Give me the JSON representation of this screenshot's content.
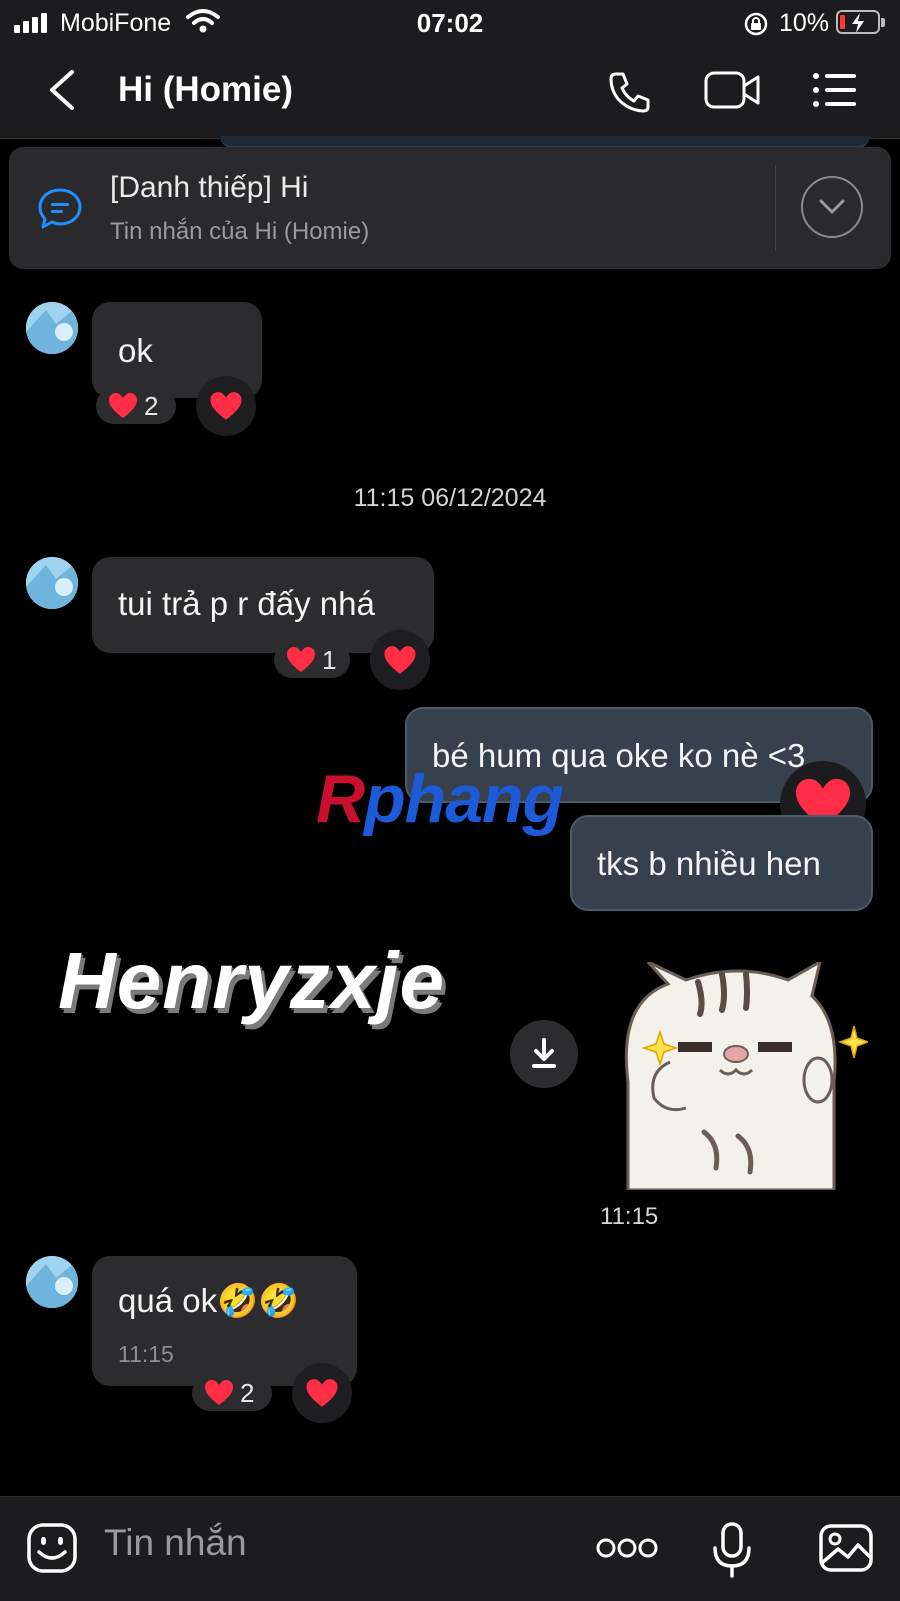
{
  "status": {
    "carrier": "MobiFone",
    "time": "07:02",
    "battery": "10%"
  },
  "header": {
    "title": "Hi (Homie)",
    "icons": [
      "back-icon",
      "phone-icon",
      "video-icon",
      "menu-icon"
    ]
  },
  "pinned": {
    "title": "[Danh thiếp] Hi",
    "subtitle": "Tin nhắn của Hi (Homie)"
  },
  "messages": [
    {
      "from": "them",
      "text": "ok",
      "reaction_count": "2"
    },
    {
      "from": "them",
      "text": "tui trả p r đấy nhá",
      "reaction_count": "1"
    },
    {
      "from": "me",
      "text": "bé hum qua oke ko nè <3"
    },
    {
      "from": "me",
      "text": "tks b nhiều hen"
    },
    {
      "from": "them",
      "text": "quá ok🤣🤣",
      "time": "11:15",
      "reaction_count": "2"
    }
  ],
  "date_separator": "11:15 06/12/2024",
  "sticker_time": "11:15",
  "overlays": {
    "watermark_red": "R",
    "watermark_blue": "phang",
    "henry": "Henryzxje"
  },
  "input": {
    "placeholder": "Tin nhắn"
  },
  "colors": {
    "background": "#000000",
    "bar": "#1c1c1e",
    "bubble_them": "#2c2c2e",
    "bubble_me": "#36414d",
    "heart": "#ff2d45",
    "link_blue": "#1e8fff"
  }
}
